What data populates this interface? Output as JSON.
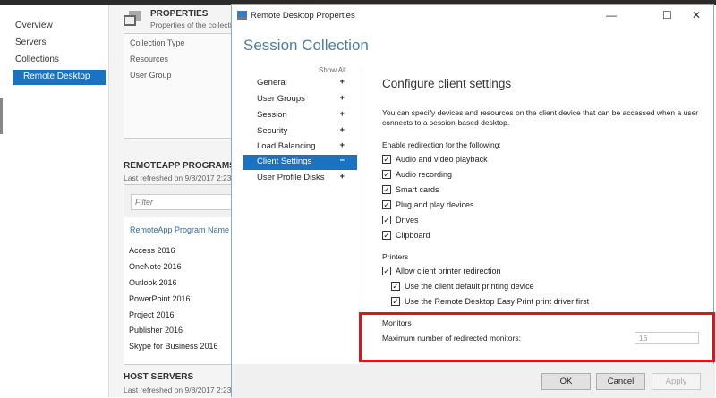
{
  "left_nav": {
    "items": [
      "Overview",
      "Servers",
      "Collections",
      "Remote Desktop"
    ]
  },
  "properties": {
    "title": "PROPERTIES",
    "subtitle": "Properties of the collection",
    "fields": [
      "Collection Type",
      "Resources",
      "User Group"
    ]
  },
  "remoteapp": {
    "title": "REMOTEAPP PROGRAMS",
    "refreshed": "Last refreshed on 9/8/2017 2:23",
    "filter_placeholder": "Filter",
    "column": "RemoteApp Program Name",
    "programs": [
      "Access 2016",
      "OneNote 2016",
      "Outlook 2016",
      "PowerPoint 2016",
      "Project 2016",
      "Publisher 2016",
      "Skype for Business 2016"
    ]
  },
  "host_servers": {
    "title": "HOST SERVERS",
    "refreshed": "Last refreshed on 9/8/2017 2:23"
  },
  "dialog": {
    "title": "Remote Desktop Properties",
    "heading": "Session Collection",
    "show_all": "Show All",
    "categories": [
      {
        "label": "General",
        "sign": "+"
      },
      {
        "label": "User Groups",
        "sign": "+"
      },
      {
        "label": "Session",
        "sign": "+"
      },
      {
        "label": "Security",
        "sign": "+"
      },
      {
        "label": "Load Balancing",
        "sign": "+"
      },
      {
        "label": "Client Settings",
        "sign": "−"
      },
      {
        "label": "User Profile Disks",
        "sign": "+"
      }
    ],
    "section_title": "Configure client settings",
    "description": "You can specify devices and resources on the client device that can be accessed when a user connects to a session-based desktop.",
    "redirect_label": "Enable redirection for the following:",
    "redirects": [
      "Audio and video playback",
      "Audio recording",
      "Smart cards",
      "Plug and play devices",
      "Drives",
      "Clipboard"
    ],
    "printers_label": "Printers",
    "printer_options": [
      "Allow client printer redirection",
      "Use the client default printing device",
      "Use the Remote Desktop Easy Print print driver first"
    ],
    "monitors_label": "Monitors",
    "monitors_field_label": "Maximum number of redirected monitors:",
    "monitors_value": "16",
    "buttons": {
      "ok": "OK",
      "cancel": "Cancel",
      "apply": "Apply"
    }
  },
  "colors": {
    "accent": "#1a73c1",
    "highlight": "#e0141e"
  }
}
